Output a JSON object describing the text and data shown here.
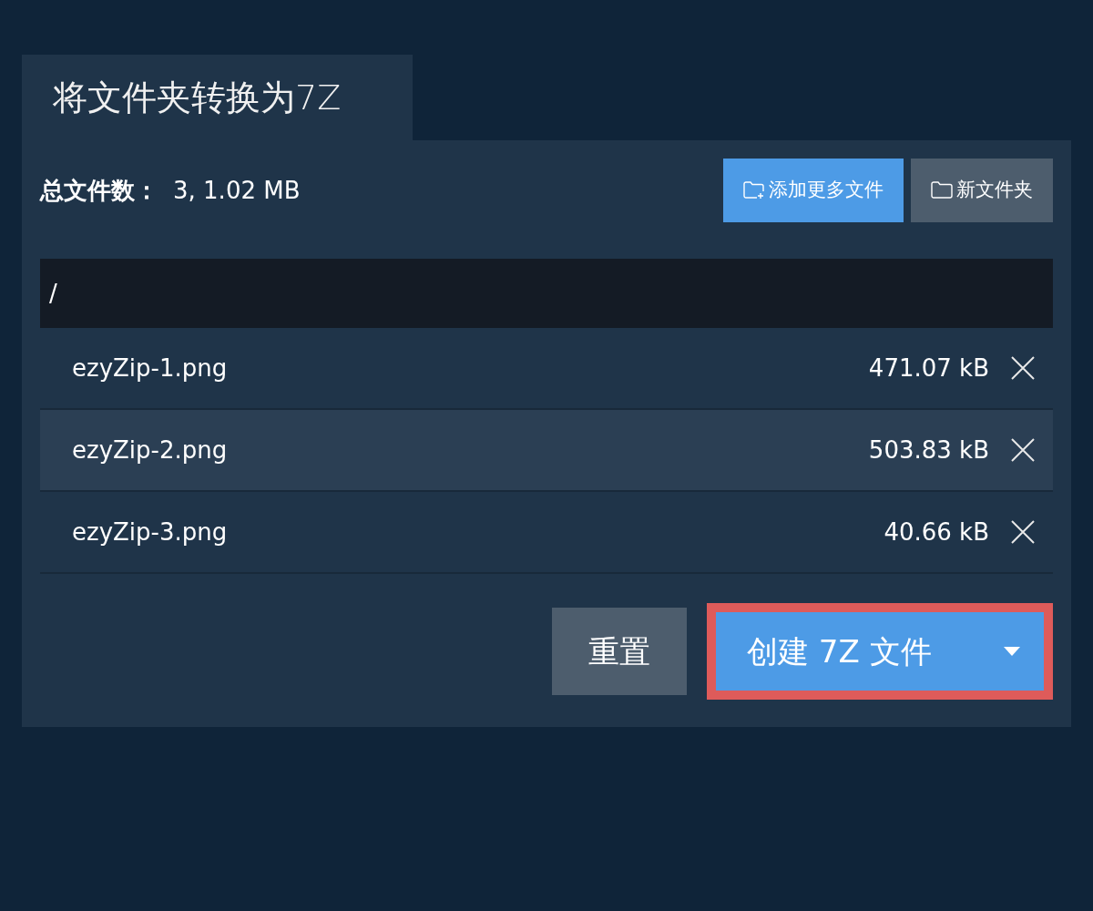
{
  "tab": {
    "title": "将文件夹转换为7Z"
  },
  "summary": {
    "label": "总文件数：",
    "value": "3, 1.02 MB"
  },
  "toolbar": [
    {
      "label": "添加更多文件",
      "kind": "add"
    },
    {
      "label": "新文件夹",
      "kind": "folder"
    }
  ],
  "path": "/",
  "files": [
    {
      "name": "ezyZip-1.png",
      "size": "471.07 kB",
      "highlighted": false
    },
    {
      "name": "ezyZip-2.png",
      "size": "503.83 kB",
      "highlighted": true
    },
    {
      "name": "ezyZip-3.png",
      "size": "40.66 kB",
      "highlighted": false
    }
  ],
  "actions": {
    "reset": "重置",
    "create": "创建 7Z 文件",
    "focused": true
  }
}
